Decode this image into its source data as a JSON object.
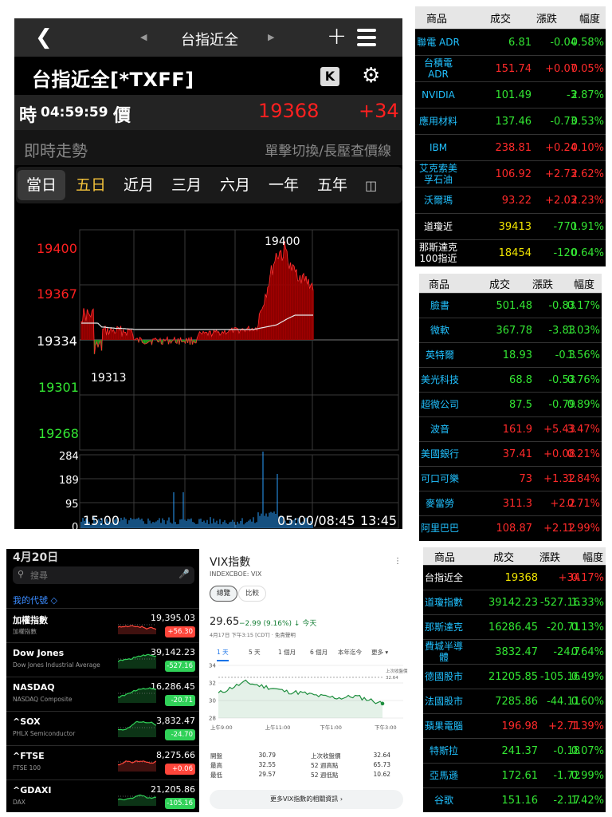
{
  "futures": {
    "nav_title": "台指近全",
    "symbol_title": "台指近全[*TXFF]",
    "k_label": "K",
    "time_label": "時",
    "time_value": "04:59:59",
    "price_label": "價",
    "price": "19368",
    "change": "+34",
    "realtime_label": "即時走勢",
    "hint": "單擊切換/長壓查價線",
    "tabs": [
      "當日",
      "五日",
      "近月",
      "三月",
      "六月",
      "一年",
      "五年"
    ],
    "chart": {
      "price_ticks": [
        "19400",
        "19367",
        "19334",
        "19301",
        "19268"
      ],
      "high_label": "19400",
      "low_label": "19313",
      "volume_ticks": [
        "284",
        "189",
        "95",
        "0"
      ],
      "time_labels": [
        "15:00",
        "05:00/08:45",
        "13:45"
      ]
    }
  },
  "table_us_adr": {
    "headers": [
      "商品",
      "成交",
      "漲跌",
      "幅度"
    ],
    "rows": [
      {
        "name": "聯電 ADR",
        "price": "6.81",
        "change": "-0.04",
        "pct": "0.58%",
        "dir": "dn"
      },
      {
        "name": "台積電 ADR",
        "price": "151.74",
        "change": "+0.07",
        "pct": "0.05%",
        "dir": "up"
      },
      {
        "name": "NVIDIA",
        "price": "101.49",
        "change": "-3",
        "pct": "2.87%",
        "dir": "dn"
      },
      {
        "name": "應用材料",
        "price": "137.46",
        "change": "-0.73",
        "pct": "0.53%",
        "dir": "dn"
      },
      {
        "name": "IBM",
        "price": "238.81",
        "change": "+0.24",
        "pct": "0.10%",
        "dir": "up"
      },
      {
        "name": "艾克索美孚石油",
        "price": "106.92",
        "change": "+2.73",
        "pct": "2.62%",
        "dir": "up"
      },
      {
        "name": "沃爾瑪",
        "price": "93.22",
        "change": "+2.03",
        "pct": "2.23%",
        "dir": "up"
      },
      {
        "name": "道瓊近",
        "price": "39413",
        "change": "-770",
        "pct": "1.91%",
        "dir": "dn",
        "white": true
      },
      {
        "name": "那斯達克100指近",
        "price": "18454",
        "change": "-120",
        "pct": "0.64%",
        "dir": "dn",
        "white": true
      }
    ]
  },
  "table_us_stocks": {
    "headers": [
      "商品",
      "成交",
      "漲跌",
      "幅度"
    ],
    "rows": [
      {
        "name": "臉書",
        "price": "501.48",
        "change": "-0.83",
        "pct": "0.17%",
        "dir": "dn"
      },
      {
        "name": "微軟",
        "price": "367.78",
        "change": "-3.83",
        "pct": "1.03%",
        "dir": "dn"
      },
      {
        "name": "英特爾",
        "price": "18.93",
        "change": "-0.3",
        "pct": "1.56%",
        "dir": "dn"
      },
      {
        "name": "美光科技",
        "price": "68.8",
        "change": "-0.53",
        "pct": "0.76%",
        "dir": "dn"
      },
      {
        "name": "超微公司",
        "price": "87.5",
        "change": "-0.79",
        "pct": "0.89%",
        "dir": "dn"
      },
      {
        "name": "波音",
        "price": "161.9",
        "change": "+5.43",
        "pct": "3.47%",
        "dir": "up"
      },
      {
        "name": "美國銀行",
        "price": "37.41",
        "change": "+0.08",
        "pct": "0.21%",
        "dir": "up"
      },
      {
        "name": "可口可樂",
        "price": "73",
        "change": "+1.32",
        "pct": "1.84%",
        "dir": "up"
      },
      {
        "name": "麥當勞",
        "price": "311.3",
        "change": "+2.2",
        "pct": "0.71%",
        "dir": "up"
      },
      {
        "name": "阿里巴巴",
        "price": "108.87",
        "change": "+2.12",
        "pct": "1.99%",
        "dir": "up"
      }
    ]
  },
  "table_global": {
    "headers": [
      "商品",
      "成交",
      "漲跌",
      "幅度"
    ],
    "rows": [
      {
        "name": "台指近全",
        "price": "19368",
        "change": "+34",
        "pct": "0.17%",
        "dir": "up",
        "white": true
      },
      {
        "name": "道瓊指數",
        "price": "39142.23",
        "change": "-527.16",
        "pct": "1.33%",
        "dir": "dn"
      },
      {
        "name": "那斯達克",
        "price": "16286.45",
        "change": "-20.71",
        "pct": "0.13%",
        "dir": "dn"
      },
      {
        "name": "費城半導體",
        "price": "3832.47",
        "change": "-24.7",
        "pct": "0.64%",
        "dir": "dn"
      },
      {
        "name": "德國股市",
        "price": "21205.85",
        "change": "-105.16",
        "pct": "0.49%",
        "dir": "dn"
      },
      {
        "name": "法國股市",
        "price": "7285.86",
        "change": "-44.11",
        "pct": "0.60%",
        "dir": "dn"
      },
      {
        "name": "蘋果電腦",
        "price": "196.98",
        "change": "+2.71",
        "pct": "1.39%",
        "dir": "up"
      },
      {
        "name": "特斯拉",
        "price": "241.37",
        "change": "-0.18",
        "pct": "0.07%",
        "dir": "dn"
      },
      {
        "name": "亞馬遜",
        "price": "172.61",
        "change": "-1.72",
        "pct": "0.99%",
        "dir": "dn"
      },
      {
        "name": "谷歌",
        "price": "151.16",
        "change": "-2.17",
        "pct": "1.42%",
        "dir": "dn"
      }
    ]
  },
  "stocks_app": {
    "date": "4月20日",
    "search_placeholder": "搜尋",
    "my_symbols": "我的代號 ◇",
    "items": [
      {
        "symbol": "加權指數",
        "name": "加權指數",
        "price": "19,395.03",
        "change": "+56.30",
        "dir": "red"
      },
      {
        "symbol": "Dow Jones",
        "name": "Dow Jones Industrial Average",
        "price": "39,142.23",
        "change": "-527.16",
        "dir": "green"
      },
      {
        "symbol": "NASDAQ",
        "name": "NASDAQ Composite",
        "price": "16,286.45",
        "change": "-20.71",
        "dir": "green"
      },
      {
        "symbol": "^SOX",
        "name": "PHLX Semiconductor",
        "price": "3,832.47",
        "change": "-24.70",
        "dir": "green"
      },
      {
        "symbol": "^FTSE",
        "name": "FTSE 100",
        "price": "8,275.66",
        "change": "+0.06",
        "dir": "red"
      },
      {
        "symbol": "^GDAXI",
        "name": "DAX",
        "price": "21,205.86",
        "change": "-105.16",
        "dir": "green"
      }
    ]
  },
  "vix": {
    "title": "VIX指數",
    "subtitle": "INDEXCBOE: VIX",
    "tab_overview": "總覽",
    "tab_compare": "比較",
    "price": "29.65",
    "change": "−2.99 (9.16%) ↓ 今天",
    "timestamp": "4月17日 下午3:15 [CDT] · 免責聲明",
    "ranges": [
      "1 天",
      "5 天",
      "1 個月",
      "6 個月",
      "本年迄今",
      "更多 ▾"
    ],
    "y_ticks": [
      "34",
      "32",
      "30",
      "28"
    ],
    "x_ticks": [
      "上午9:00",
      "上午11:00",
      "下午1:00",
      "下午3:00"
    ],
    "prev_close_label": "上次收盤價",
    "prev_close_value": "32.64",
    "stats": [
      {
        "k": "開盤",
        "v": "30.79",
        "k2": "上次收盤價",
        "v2": "32.64"
      },
      {
        "k": "最高",
        "v": "32.55",
        "k2": "52 週高點",
        "v2": "65.73"
      },
      {
        "k": "最低",
        "v": "29.57",
        "k2": "52 週低點",
        "v2": "10.62"
      }
    ],
    "more_button": "更多VIX指數的相關資訊 ›",
    "chart_data": {
      "type": "line",
      "title": "VIX指數",
      "x": [
        "9:00",
        "9:30",
        "10:00",
        "10:30",
        "11:00",
        "11:30",
        "12:00",
        "12:30",
        "13:00",
        "13:30",
        "14:00",
        "14:30",
        "15:00"
      ],
      "values": [
        30.8,
        31.5,
        32.1,
        31.7,
        31.4,
        31.0,
        30.9,
        30.6,
        30.4,
        30.3,
        30.5,
        30.1,
        29.65
      ],
      "ylim": [
        28,
        34
      ],
      "reference_line": 32.64
    }
  },
  "colors": {
    "up": "#ff2a2a",
    "down": "#33e633",
    "name_blue": "#21c1ff",
    "selected_tab": "#f5c33b"
  }
}
